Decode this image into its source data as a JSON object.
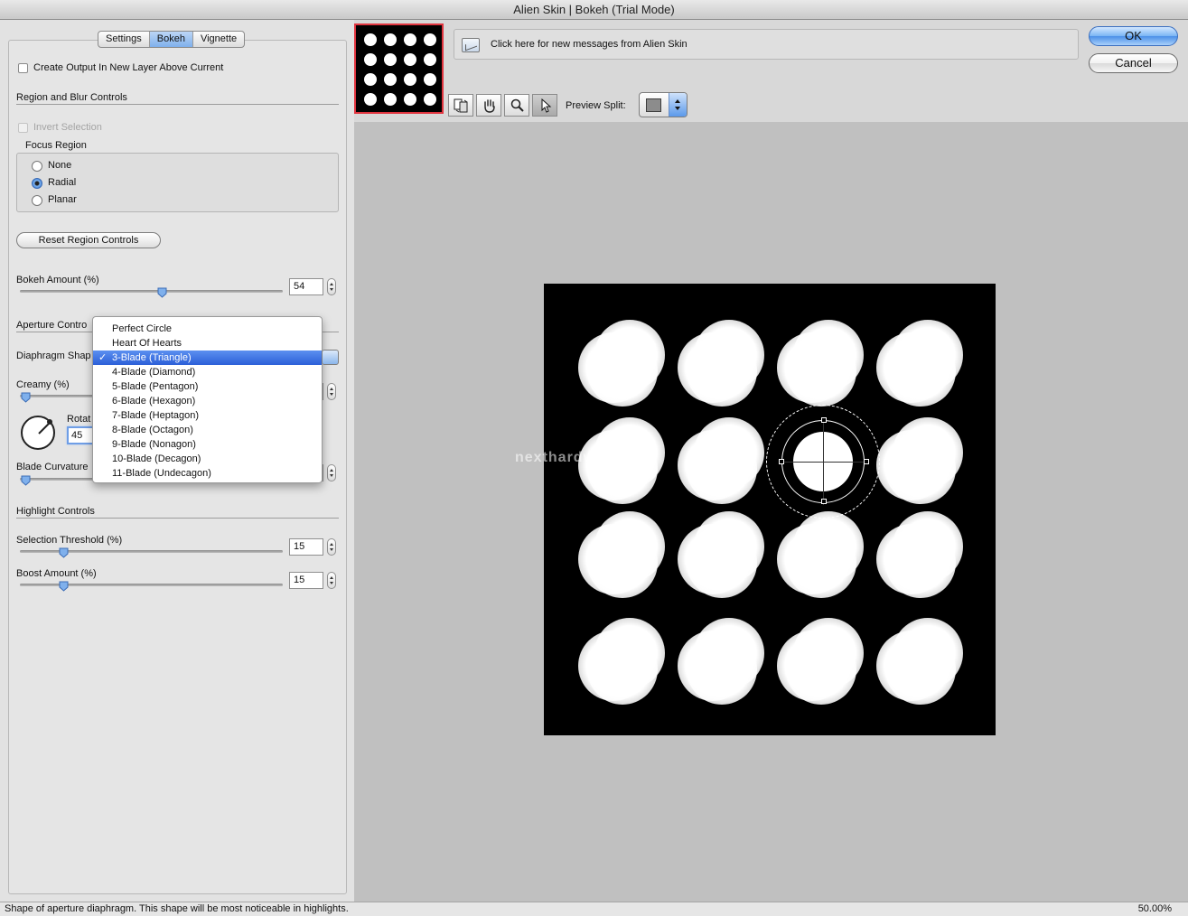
{
  "window": {
    "title": "Alien Skin | Bokeh (Trial Mode)"
  },
  "tabs": [
    {
      "label": "Settings",
      "active": false
    },
    {
      "label": "Bokeh",
      "active": true
    },
    {
      "label": "Vignette",
      "active": false
    }
  ],
  "create_output": {
    "label": "Create Output In New Layer Above Current",
    "checked": false
  },
  "region": {
    "section_title": "Region and Blur Controls",
    "invert_selection": {
      "label": "Invert Selection",
      "checked": false,
      "disabled": true
    },
    "focus_region_label": "Focus Region",
    "focus_options": [
      {
        "label": "None",
        "selected": false
      },
      {
        "label": "Radial",
        "selected": true
      },
      {
        "label": "Planar",
        "selected": false
      }
    ],
    "reset_button": "Reset Region Controls"
  },
  "bokeh_amount": {
    "label": "Bokeh Amount (%)",
    "value": "54",
    "fraction": 0.54
  },
  "aperture": {
    "section_title": "Aperture Contro",
    "diaphragm_label": "Diaphragm Shap",
    "creamy_label": "Creamy (%)",
    "rotation_label": "Rotat",
    "rotation_value": "45",
    "blade_curvature_label": "Blade Curvature",
    "shape_options": [
      "Perfect Circle",
      "Heart Of Hearts",
      "3-Blade (Triangle)",
      "4-Blade (Diamond)",
      "5-Blade (Pentagon)",
      "6-Blade (Hexagon)",
      "7-Blade (Heptagon)",
      "8-Blade (Octagon)",
      "9-Blade (Nonagon)",
      "10-Blade (Decagon)",
      "11-Blade (Undecagon)"
    ],
    "selected_shape": "3-Blade (Triangle)",
    "check_mark": "✓"
  },
  "highlight": {
    "section_title": "Highlight Controls",
    "selection_threshold": {
      "label": "Selection Threshold (%)",
      "value": "15",
      "fraction": 0.15
    },
    "boost_amount": {
      "label": "Boost Amount (%)",
      "value": "15",
      "fraction": 0.15
    }
  },
  "messages": {
    "text": "Click here for new messages from Alien Skin"
  },
  "buttons": {
    "ok": "OK",
    "cancel": "Cancel"
  },
  "toolbar": {
    "tools": [
      "compare-icon",
      "hand-icon",
      "zoom-icon",
      "pointer-icon"
    ],
    "active_tool": "pointer-icon",
    "preview_split_label": "Preview Split:"
  },
  "preview": {
    "watermark": "nexthardware.com"
  },
  "status": {
    "text": "Shape of aperture diaphragm.  This shape will be most noticeable in highlights.",
    "zoom": "50.00%"
  },
  "colors": {
    "accent": "#3f7fd6",
    "selected_row": "#2c5fd8",
    "thumbnail_border": "#e0353f"
  }
}
